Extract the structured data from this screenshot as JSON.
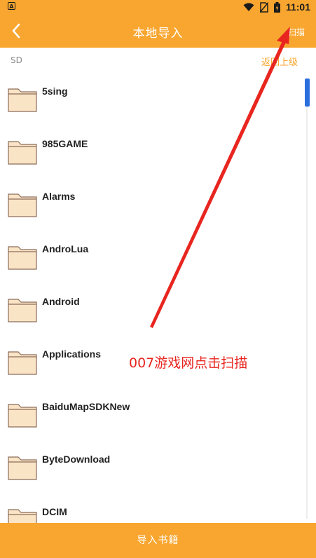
{
  "status_bar": {
    "left_icon": "A",
    "time": "11:01",
    "icons": [
      "wifi-icon",
      "no-sim-icon",
      "battery-icon"
    ]
  },
  "toolbar": {
    "back_icon": "chevron-left-icon",
    "title": "本地导入",
    "scan_label": "扫描"
  },
  "path": {
    "current": "SD",
    "back_up_label": "返回上级"
  },
  "folders": [
    {
      "name": "5sing"
    },
    {
      "name": "985GAME"
    },
    {
      "name": "Alarms"
    },
    {
      "name": "AndroLua"
    },
    {
      "name": "Android"
    },
    {
      "name": "Applications"
    },
    {
      "name": "BaiduMapSDKNew"
    },
    {
      "name": "ByteDownload"
    },
    {
      "name": "DCIM"
    }
  ],
  "import_button": {
    "label": "导入书籍"
  },
  "annotation": {
    "text": "007游戏网点击扫描"
  },
  "colors": {
    "accent": "#f8a630",
    "folder_fill": "#fae4c6",
    "folder_stroke": "#8c6c5a",
    "scroll_thumb": "#2b6fde",
    "annotation": "#e8251f"
  }
}
